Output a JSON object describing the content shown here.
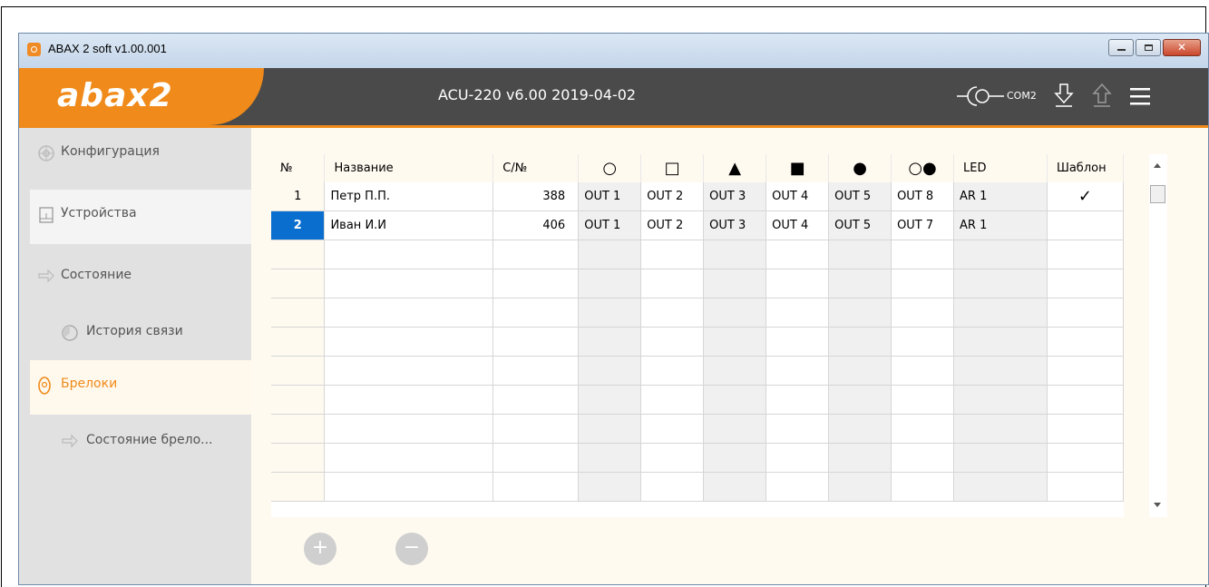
{
  "window": {
    "title": "ABAX 2 soft v1.00.001"
  },
  "header": {
    "logo": "abax2",
    "device_info": "ACU-220 v6.00 2019-04-02",
    "com_port": "COM2"
  },
  "sidebar": {
    "items": [
      {
        "label": "Конфигурация",
        "icon": "settings-icon",
        "state": "normal"
      },
      {
        "label": "Устройства",
        "icon": "device-icon",
        "state": "selected"
      },
      {
        "label": "Состояние",
        "icon": "arrows-icon",
        "state": "normal"
      },
      {
        "label": "История связи",
        "icon": "history-icon",
        "state": "normal"
      },
      {
        "label": "Брелоки",
        "icon": "keyfob-icon",
        "state": "active"
      },
      {
        "label": "Состояние брело...",
        "icon": "arrows-icon",
        "state": "normal"
      }
    ]
  },
  "table": {
    "headers": [
      "№",
      "Название",
      "С/№",
      "○",
      "□",
      "▲",
      "■",
      "●",
      "○●",
      "LED",
      "Шаблон"
    ],
    "rows": [
      {
        "num": "1",
        "name": "Петр П.П.",
        "sn": "388",
        "o1": "OUT 1",
        "o2": "OUT 2",
        "o3": "OUT 3",
        "o4": "OUT 4",
        "o5": "OUT 5",
        "o6": "OUT 8",
        "led": "AR 1",
        "template": "✓"
      },
      {
        "num": "2",
        "name": "Иван И.И",
        "sn": "406",
        "o1": "OUT 1",
        "o2": "OUT 2",
        "o3": "OUT 3",
        "o4": "OUT 4",
        "o5": "OUT 5",
        "o6": "OUT 7",
        "led": "AR 1",
        "template": ""
      }
    ],
    "selected_row": "2"
  },
  "actions": {
    "add": "+",
    "remove": "−"
  },
  "colors": {
    "accent": "#f08a1a",
    "header_bg": "#4a4a4a",
    "selection": "#0a6ecf"
  }
}
